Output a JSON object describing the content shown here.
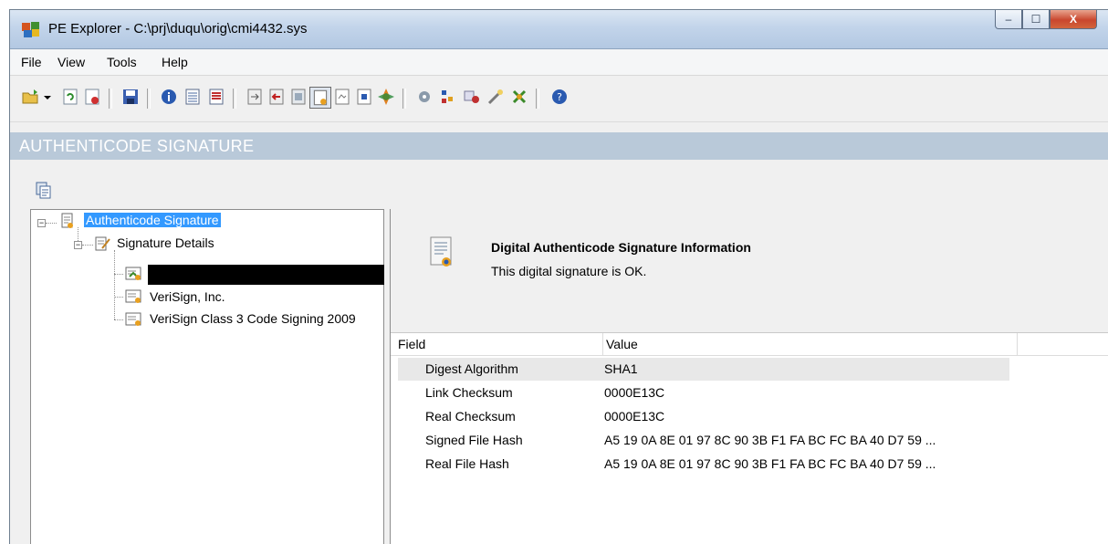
{
  "window": {
    "title": "PE Explorer - C:\\prj\\duqu\\orig\\cmi4432.sys",
    "buttons": {
      "minimize": "–",
      "maximize": "☐",
      "close": "X"
    }
  },
  "menu": {
    "items": [
      {
        "label": "File"
      },
      {
        "label": "View"
      },
      {
        "label": "Tools"
      },
      {
        "label": "Help"
      }
    ]
  },
  "toolbar": {
    "icons": [
      "open-icon",
      "dropdown-arrow-icon",
      "refresh-icon",
      "close-file-icon",
      "save-icon",
      "info-icon",
      "headers-icon",
      "sections-icon",
      "exports-icon",
      "imports-icon",
      "resources-icon",
      "signature-icon",
      "debug-icon",
      "dependency-icon",
      "disassembler-icon",
      "tools-icon",
      "syntax-icon",
      "resource-editor-icon",
      "wizard-icon",
      "plugin-icon",
      "help-icon"
    ]
  },
  "section": {
    "title": "AUTHENTICODE SIGNATURE"
  },
  "tree": {
    "root": "Authenticode Signature",
    "details": "Signature Details",
    "certs": [
      "VeriSign, Inc.",
      "VeriSign Class 3 Code Signing 2009"
    ]
  },
  "info": {
    "title": "Digital Authenticode Signature Information",
    "status": "This digital signature is OK."
  },
  "list": {
    "columns": [
      "Field",
      "Value"
    ],
    "rows": [
      {
        "field": "Digest Algorithm",
        "value": "SHA1"
      },
      {
        "field": "Link Checksum",
        "value": "0000E13C"
      },
      {
        "field": "Real Checksum",
        "value": "0000E13C"
      },
      {
        "field": "Signed File Hash",
        "value": "A5 19 0A 8E 01 97 8C 90 3B F1 FA BC FC BA 40 D7 59 ..."
      },
      {
        "field": "Real File Hash",
        "value": "A5 19 0A 8E 01 97 8C 90 3B F1 FA BC FC BA 40 D7 59 ..."
      }
    ]
  },
  "colors": {
    "header_bar": "#b9c9d9",
    "selection": "#3399ff"
  }
}
